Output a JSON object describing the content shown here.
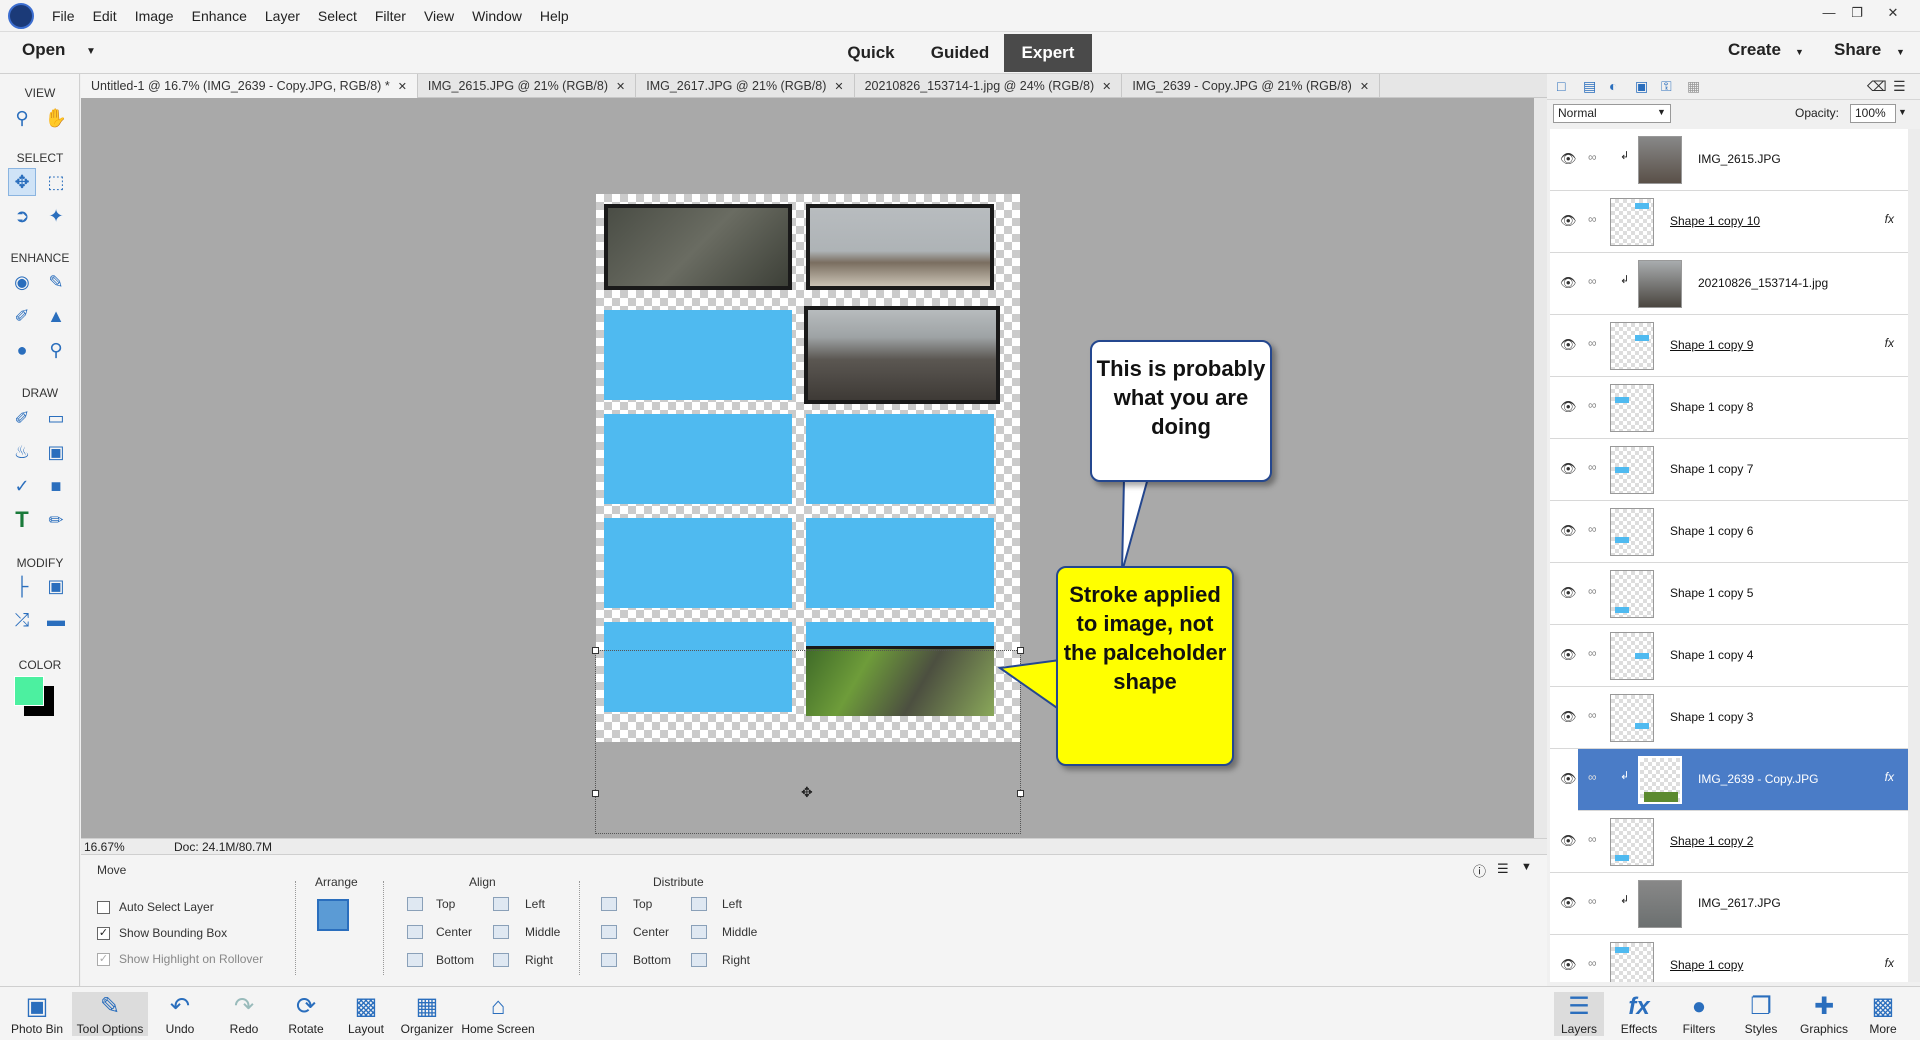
{
  "menubar": {
    "items": [
      "File",
      "Edit",
      "Image",
      "Enhance",
      "Layer",
      "Select",
      "Filter",
      "View",
      "Window",
      "Help"
    ]
  },
  "modebar": {
    "open": "Open",
    "modes": [
      "Quick",
      "Guided",
      "Expert"
    ],
    "active": "Expert",
    "create": "Create",
    "share": "Share"
  },
  "toolbox": {
    "view": "VIEW",
    "select": "SELECT",
    "enhance": "ENHANCE",
    "draw": "DRAW",
    "modify": "MODIFY",
    "color": "COLOR",
    "fg_color": "#4cf0a0",
    "bg_color": "#000000"
  },
  "tabs": [
    "Untitled-1 @ 16.7% (IMG_2639 - Copy.JPG, RGB/8) *",
    "IMG_2615.JPG @ 21% (RGB/8)",
    "IMG_2617.JPG @ 21% (RGB/8)",
    "20210826_153714-1.jpg @ 24% (RGB/8)",
    "IMG_2639 - Copy.JPG @ 21% (RGB/8)"
  ],
  "status": {
    "zoom": "16.67%",
    "doc": "Doc: 24.1M/80.7M"
  },
  "callouts": {
    "white": "This is probably what you are doing",
    "yellow": "Stroke applied to image, not the palceholder shape"
  },
  "options": {
    "title": "Move",
    "auto_select": "Auto Select Layer",
    "bounding_box": "Show Bounding Box",
    "highlight": "Show Highlight on Rollover",
    "arrange": "Arrange",
    "align": "Align",
    "distribute": "Distribute",
    "top": "Top",
    "center": "Center",
    "bottom": "Bottom",
    "left": "Left",
    "middle": "Middle",
    "right": "Right"
  },
  "layers_panel": {
    "blend_mode": "Normal",
    "opacity_label": "Opacity:",
    "opacity": "100%",
    "layers": [
      {
        "name": "IMG_2615.JPG",
        "fx": ""
      },
      {
        "name": "Shape 1 copy 10",
        "fx": "fx"
      },
      {
        "name": "20210826_153714-1.jpg",
        "fx": ""
      },
      {
        "name": "Shape 1 copy 9",
        "fx": "fx"
      },
      {
        "name": "Shape 1 copy 8",
        "fx": ""
      },
      {
        "name": "Shape 1 copy 7",
        "fx": ""
      },
      {
        "name": "Shape 1 copy 6",
        "fx": ""
      },
      {
        "name": "Shape 1 copy 5",
        "fx": ""
      },
      {
        "name": "Shape 1 copy 4",
        "fx": ""
      },
      {
        "name": "Shape 1 copy 3",
        "fx": ""
      },
      {
        "name": "IMG_2639 - Copy.JPG",
        "fx": "fx"
      },
      {
        "name": "Shape 1 copy 2",
        "fx": ""
      },
      {
        "name": "IMG_2617.JPG",
        "fx": ""
      },
      {
        "name": "Shape 1 copy",
        "fx": "fx"
      }
    ]
  },
  "taskbar": {
    "left": [
      "Photo Bin",
      "Tool Options",
      "Undo",
      "Redo",
      "Rotate",
      "Layout",
      "Organizer",
      "Home Screen"
    ],
    "right": [
      "Layers",
      "Effects",
      "Filters",
      "Styles",
      "Graphics",
      "More"
    ]
  }
}
